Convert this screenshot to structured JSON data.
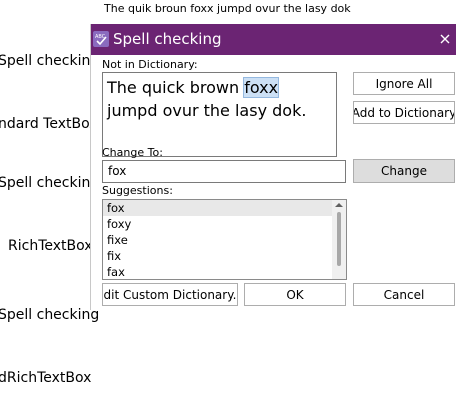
{
  "background": {
    "top_text": "The quik broun foxx jumpd ovur the lasy dok",
    "labels": [
      {
        "line1": "Spell checking",
        "line2": "ndard TextBox"
      },
      {
        "line1": "Spell checking",
        "line2": "RichTextBox"
      },
      {
        "line1": "Spell checking",
        "line2": "dRichTextBox"
      }
    ]
  },
  "dialog": {
    "title": "Spell checking",
    "close_glyph": "×",
    "not_in_dictionary_label": "Not in Dictionary:",
    "sentence": {
      "before": "The quick brown ",
      "highlighted": "foxx",
      "after": " jumpd ovur the lasy dok."
    },
    "ignore_all_label": "Ignore All",
    "add_to_dictionary_label": "Add to Dictionary",
    "change_to_label": "Change To:",
    "change_to_value": "fox",
    "change_label": "Change",
    "suggestions_label": "Suggestions:",
    "suggestions": [
      "fox",
      "foxy",
      "fixe",
      "fix",
      "fax"
    ],
    "edit_custom_dictionary_label": "Edit Custom Dictionary...",
    "ok_label": "OK",
    "cancel_label": "Cancel"
  },
  "colors": {
    "titlebar": "#6b2473",
    "highlight": "#cce0f5"
  }
}
